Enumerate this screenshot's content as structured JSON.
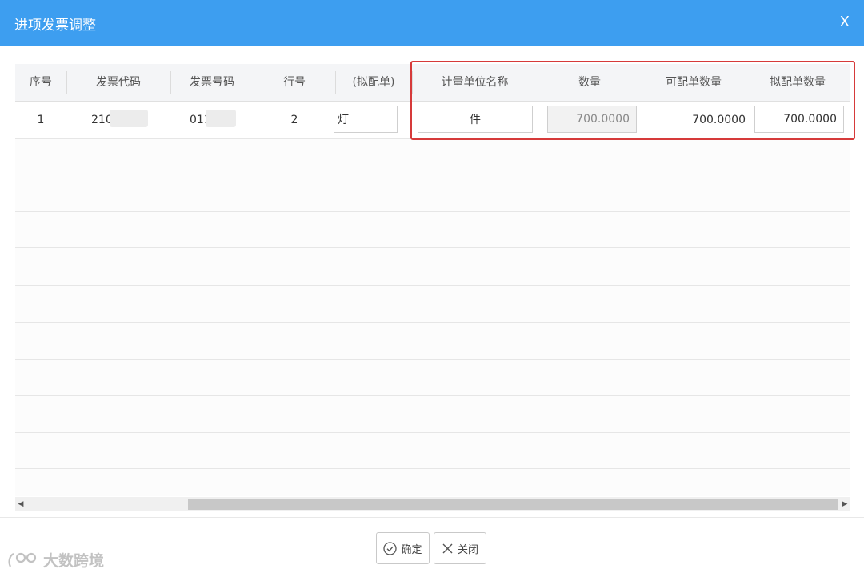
{
  "dialog": {
    "title": "进项发票调整",
    "close_label": "X"
  },
  "table": {
    "headers": {
      "seq": "序号",
      "invoice_code": "发票代码",
      "invoice_number": "发票号码",
      "line_no": "行号",
      "match_name": "(拟配单)",
      "unit_name": "计量单位名称",
      "quantity": "数量",
      "matchable_qty": "可配单数量",
      "planned_qty": "拟配单数量"
    },
    "row": {
      "seq": "1",
      "invoice_code": "210",
      "invoice_number": "011",
      "line_no": "2",
      "match_name": "灯",
      "unit_name": "件",
      "quantity": "700.0000",
      "matchable_qty": "700.0000",
      "planned_qty": "700.0000"
    }
  },
  "buttons": {
    "confirm": "确定",
    "close": "关闭"
  },
  "watermark": {
    "text": "大数跨境"
  },
  "colors": {
    "title_bar": "#3d9ef0",
    "highlight_border": "#d63a3a"
  }
}
